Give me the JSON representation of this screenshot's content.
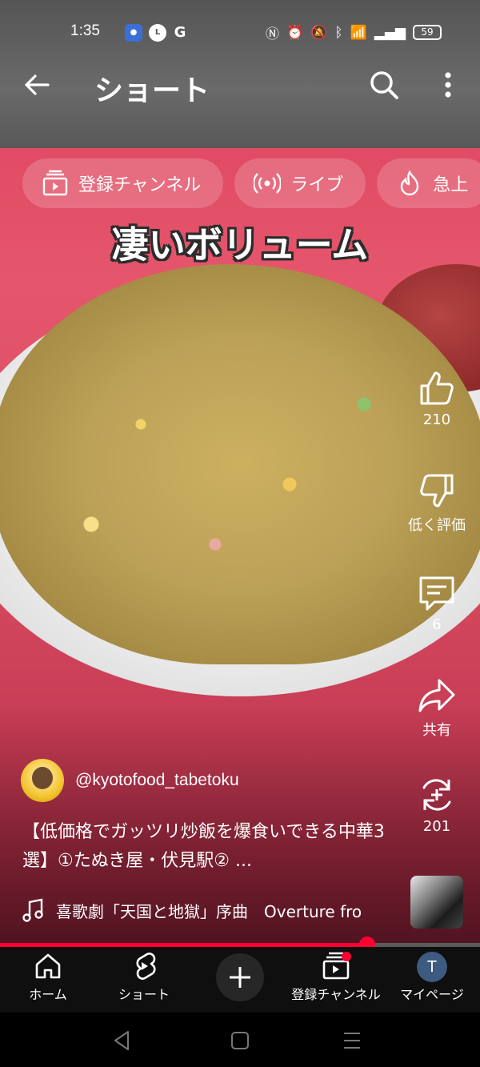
{
  "status_bar": {
    "time": "1:35",
    "battery": "59"
  },
  "header": {
    "title": "ショート"
  },
  "chips": [
    {
      "label": "登録チャンネル",
      "icon": "subscriptions-icon"
    },
    {
      "label": "ライブ",
      "icon": "live-icon"
    },
    {
      "label": "急上",
      "icon": "trending-icon"
    }
  ],
  "video": {
    "caption": "凄いボリューム"
  },
  "actions": {
    "like_count": "210",
    "dislike_label": "低く評価",
    "comment_count": "6",
    "share_label": "共有",
    "remix_count": "201"
  },
  "channel": {
    "handle": "@kyotofood_tabetoku"
  },
  "description": "【低価格でガッツリ炒飯を爆食いできる中華3選】①たぬき屋・伏見駅② ...",
  "music": {
    "title": "喜歌劇「天国と地獄」序曲　Overture fro"
  },
  "progress": {
    "fraction": 0.765
  },
  "bottom_nav": {
    "home": "ホーム",
    "shorts": "ショート",
    "subscriptions": "登録チャンネル",
    "you": "マイページ",
    "avatar_letter": "T"
  },
  "colors": {
    "accent": "#ff0033",
    "nav_bg": "#0f0f0f"
  }
}
